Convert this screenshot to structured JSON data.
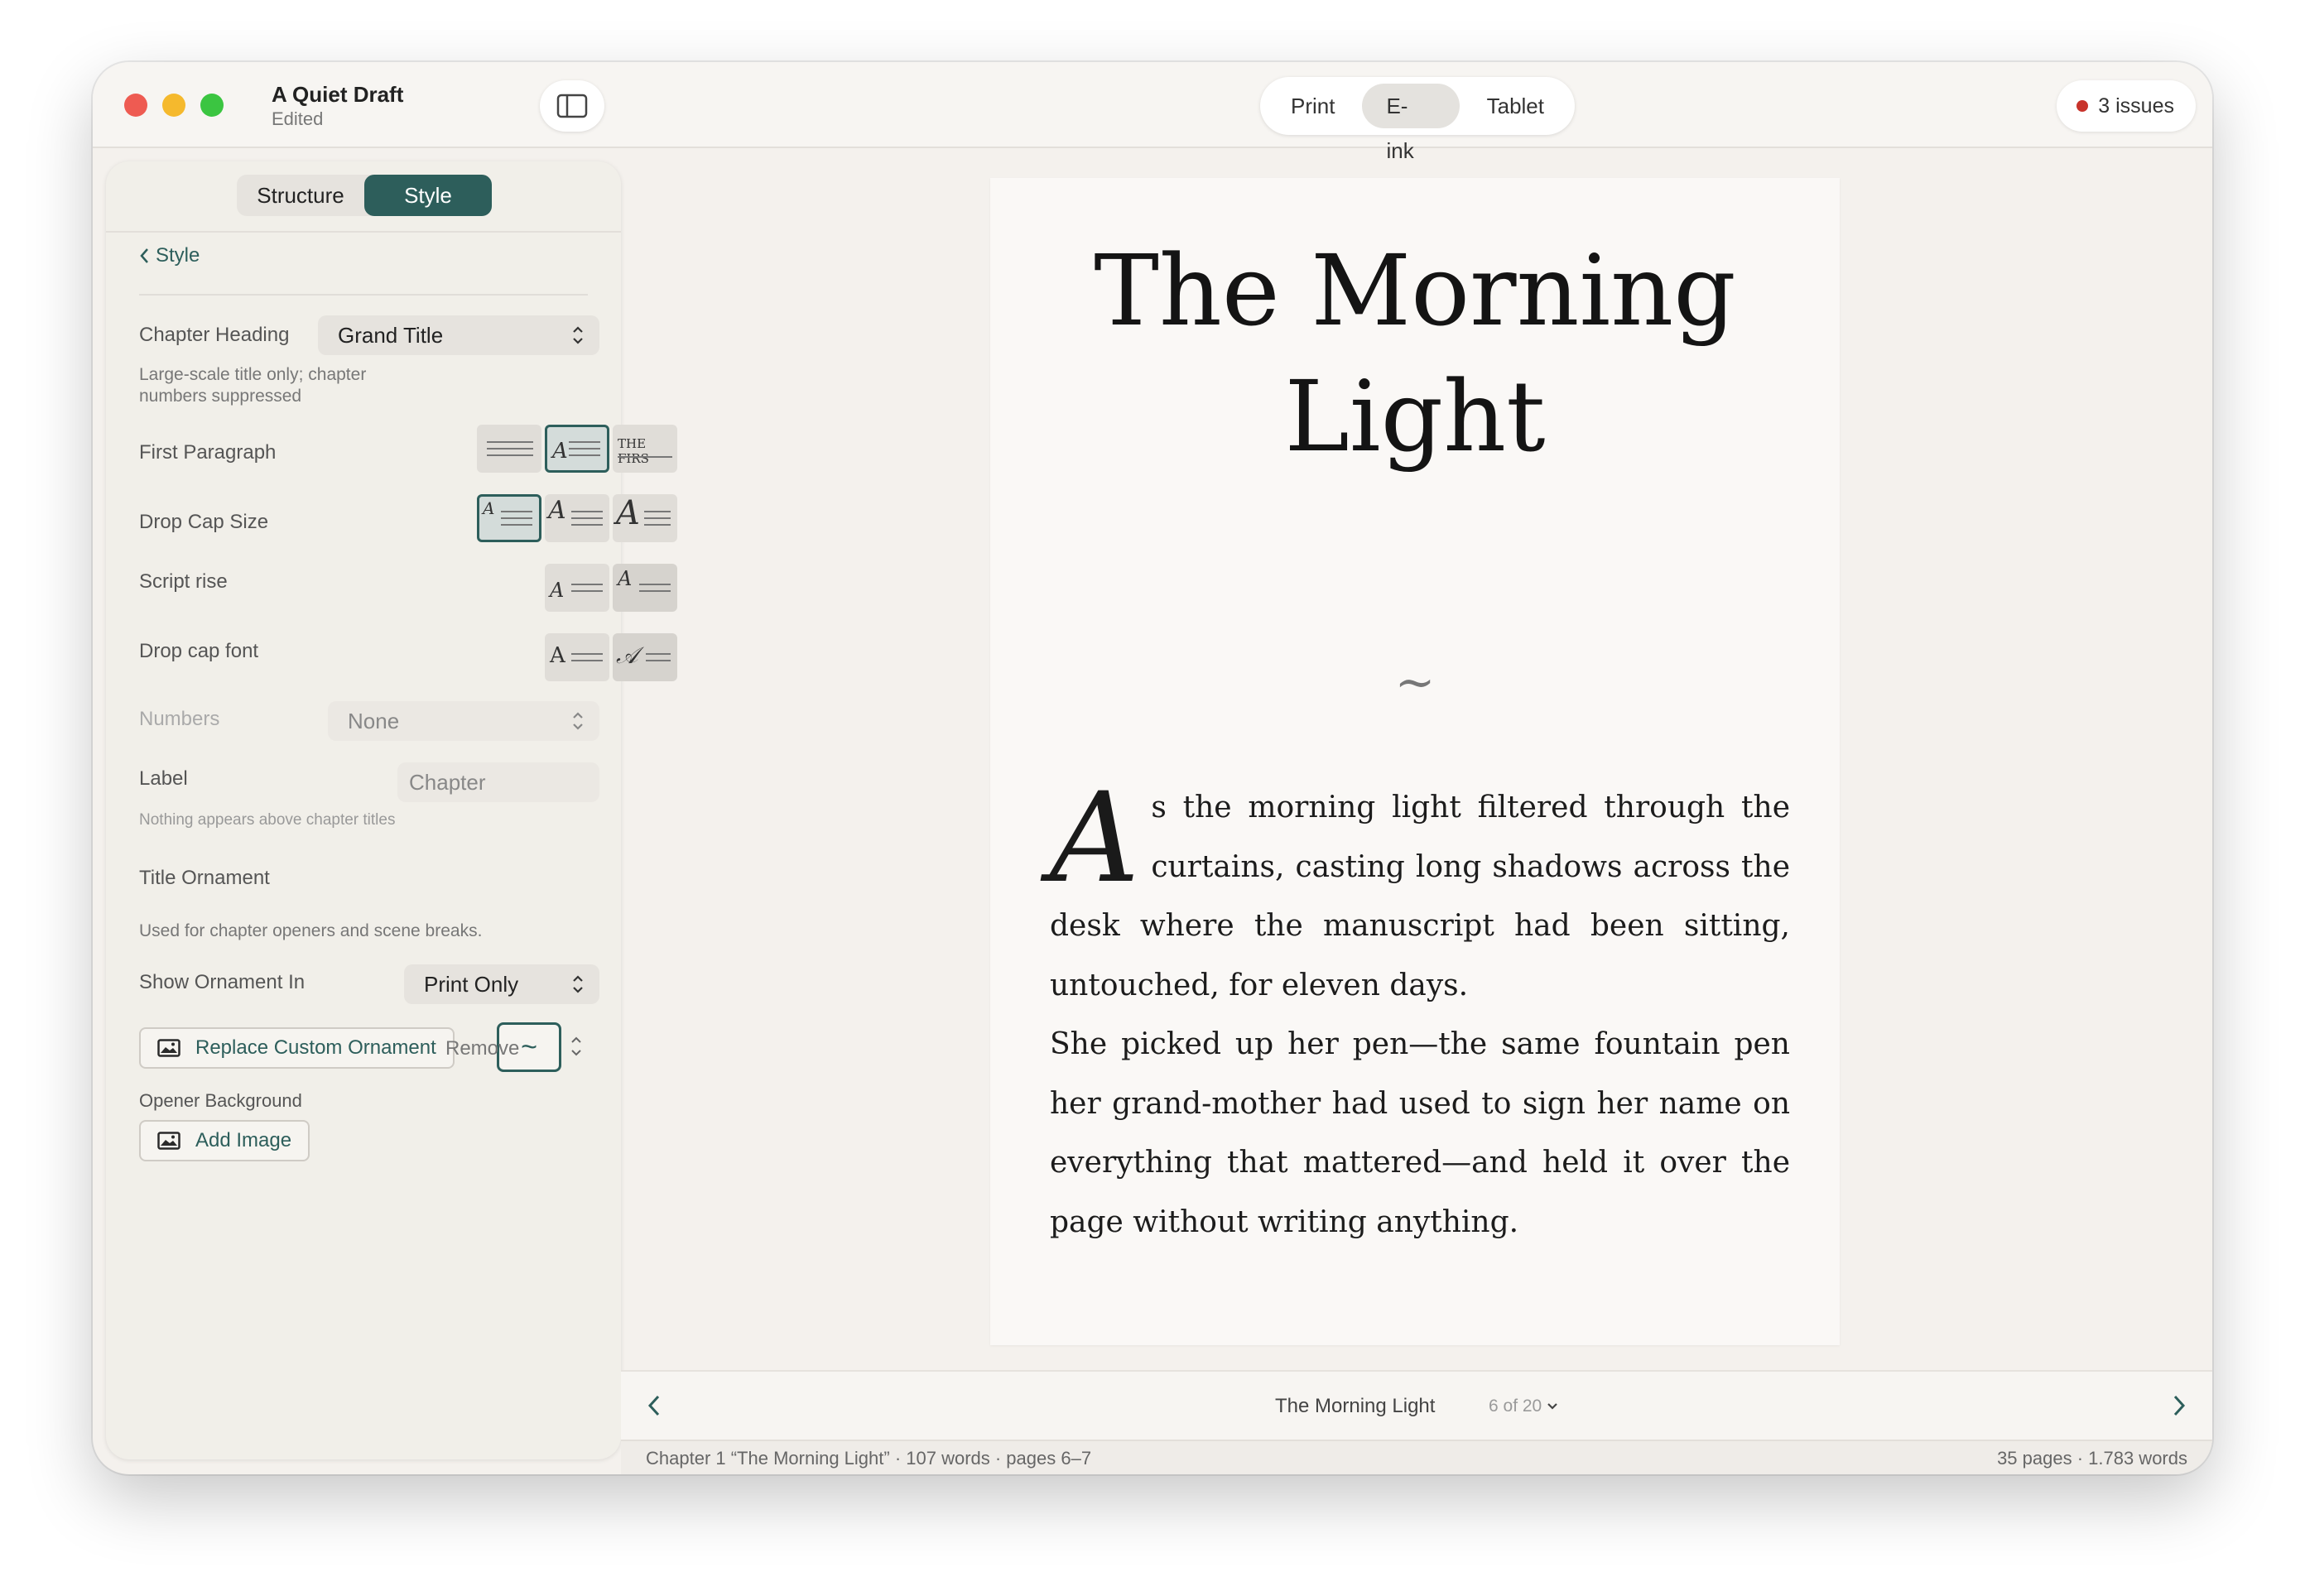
{
  "window": {
    "doc_title": "A Quiet Draft",
    "doc_status": "Edited",
    "preview_modes": [
      "Print",
      "E-ink",
      "Tablet"
    ],
    "active_mode": "E-ink",
    "issues_label": "3 issues",
    "issues_color": "#c8332b"
  },
  "panel": {
    "tabs": [
      "Structure",
      "Style"
    ],
    "active_tab": "Style",
    "back_label": "Style",
    "chapter_heading": {
      "label": "Chapter Heading",
      "value": "Grand Title",
      "help_line1": "Large-scale title only; chapter",
      "help_line2": "numbers suppressed"
    },
    "first_paragraph": {
      "label": "First Paragraph",
      "options": [
        "plain",
        "drop-cap",
        "small-caps"
      ],
      "selected": "drop-cap",
      "small_caps_sample": "THE FIRS"
    },
    "drop_cap_size": {
      "label": "Drop Cap Size",
      "options": [
        "small",
        "medium",
        "large"
      ],
      "selected": "small"
    },
    "script_rise": {
      "label": "Script rise",
      "options": [
        "baseline",
        "raised"
      ],
      "selected": "raised"
    },
    "drop_cap_font": {
      "label": "Drop cap font",
      "options": [
        "roman",
        "script"
      ],
      "selected": "script"
    },
    "numbers": {
      "label": "Numbers",
      "value": "None"
    },
    "chapter_label": {
      "label": "Label",
      "placeholder": "Chapter",
      "help": "Nothing appears above chapter titles"
    },
    "title_ornament": {
      "label": "Title Ornament",
      "value": "~",
      "help": "Used for chapter openers and scene breaks."
    },
    "show_ornament": {
      "label": "Show Ornament In",
      "value": "Print Only"
    },
    "replace_button": "Replace Custom Ornament",
    "remove_button": "Remove",
    "opener_background": {
      "label": "Opener Background",
      "button": "Add Image"
    },
    "accent": "#2d5e5b"
  },
  "page": {
    "title_line1": "The Morning",
    "title_line2": "Light",
    "ornament": "~",
    "drop_cap": "A",
    "para1_rest": "s the morning light filtered through the curtains, casting long shadows across the desk where the manuscript had been sitting, untouched, for eleven days.",
    "para2": "She picked up her pen—the same fountain pen her grand-mother had used to sign her name on everything that mattered—and held it over the page without writing anything."
  },
  "nav": {
    "chapter_title": "The Morning Light",
    "page_indicator": "6 of 20"
  },
  "status": {
    "left": "Chapter 1 “The Morning Light”  ·  107 words  ·  pages 6–7",
    "right": "35 pages  ·  1.783 words"
  }
}
